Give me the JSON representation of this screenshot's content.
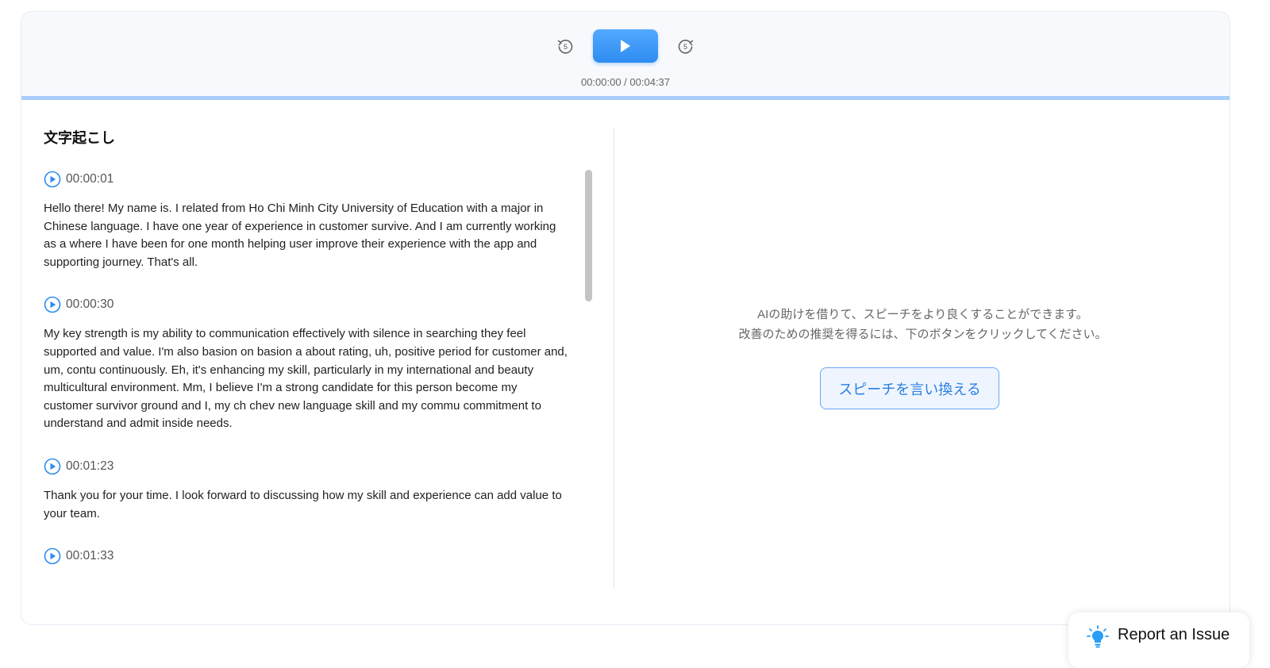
{
  "player": {
    "time_display": "00:00:00 / 00:04:37",
    "rewind_label": "5",
    "forward_label": "5",
    "progress": 1.0
  },
  "transcript": {
    "title": "文字起こし",
    "entries": [
      {
        "timestamp": "00:00:01",
        "text": "Hello there! My name is. I related from Ho Chi Minh City University of Education with a major in Chinese language. I have one year of experience in customer survive. And I am currently working as a where I have been for one month helping user improve their experience with the app and supporting journey. That's all."
      },
      {
        "timestamp": "00:00:30",
        "text": "My key strength is my ability to communication effectively with silence in searching they feel supported and value. I'm also basion on basion a about rating, uh, positive period for customer and, um, contu continuously. Eh, it's enhancing my skill, particularly in my international and beauty multicultural environment. Mm, I believe I'm a strong candidate for this person become my customer survivor ground and I, my ch chev new language skill and my commu commitment to understand and admit inside needs."
      },
      {
        "timestamp": "00:01:23",
        "text": "Thank you for your time. I look forward to discussing how my skill and experience can add value to your team."
      },
      {
        "timestamp": "00:01:33",
        "text": ""
      }
    ]
  },
  "ai_panel": {
    "line1": "AIの助けを借りて、スピーチをより良くすることができます。",
    "line2": "改善のための推奨を得るには、下のボタンをクリックしてください。",
    "button_label": "スピーチを言い換える"
  },
  "report": {
    "label": "Report an Issue"
  },
  "colors": {
    "accent": "#2e8cf0",
    "progress": "#a9cdfa",
    "report_icon": "#2a9df4"
  }
}
